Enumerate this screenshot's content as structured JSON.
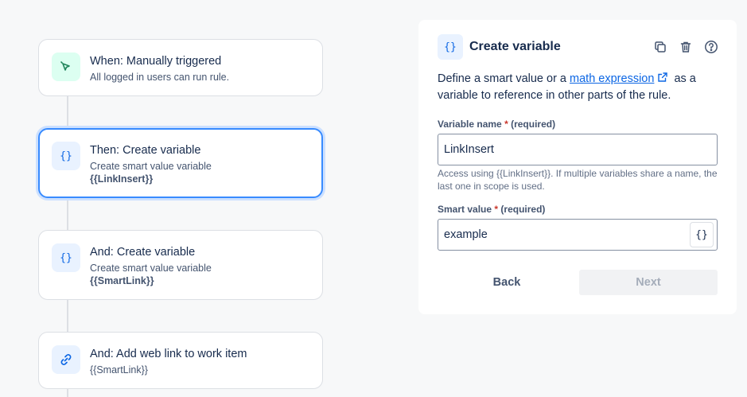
{
  "flow": {
    "trigger": {
      "title": "When: Manually triggered",
      "subtitle": "All logged in users can run rule.",
      "icon": "cursor-click-icon"
    },
    "steps": [
      {
        "title": "Then: Create variable",
        "line1": "Create smart value variable",
        "line2": "{{LinkInsert}}",
        "icon_glyph": "{}",
        "selected": true
      },
      {
        "title": "And: Create variable",
        "line1": "Create smart value variable",
        "line2": "{{SmartLink}}",
        "icon_glyph": "{}",
        "selected": false
      },
      {
        "title": "And: Add web link to work item",
        "line1": "{{SmartLink}}",
        "icon": "link-icon",
        "selected": false
      }
    ]
  },
  "panel": {
    "icon_glyph": "{}",
    "title": "Create variable",
    "description_before": "Define a smart value or a ",
    "description_link": "math expression",
    "description_after": " as a variable to reference in other parts of the rule.",
    "variable_name": {
      "label": "Variable name",
      "required_mark": "*",
      "required_text": "(required)",
      "value": "LinkInsert",
      "helper": "Access using {{LinkInsert}}. If multiple variables share a name, the last one in scope is used."
    },
    "smart_value": {
      "label": "Smart value",
      "required_mark": "*",
      "required_text": "(required)",
      "value": "example",
      "button_glyph": "{}"
    },
    "back_label": "Back",
    "next_label": "Next"
  },
  "colors": {
    "accent": "#0c66e4",
    "selected_border": "#388bff",
    "required": "#c9372c",
    "trigger_icon": "#1f845a"
  }
}
